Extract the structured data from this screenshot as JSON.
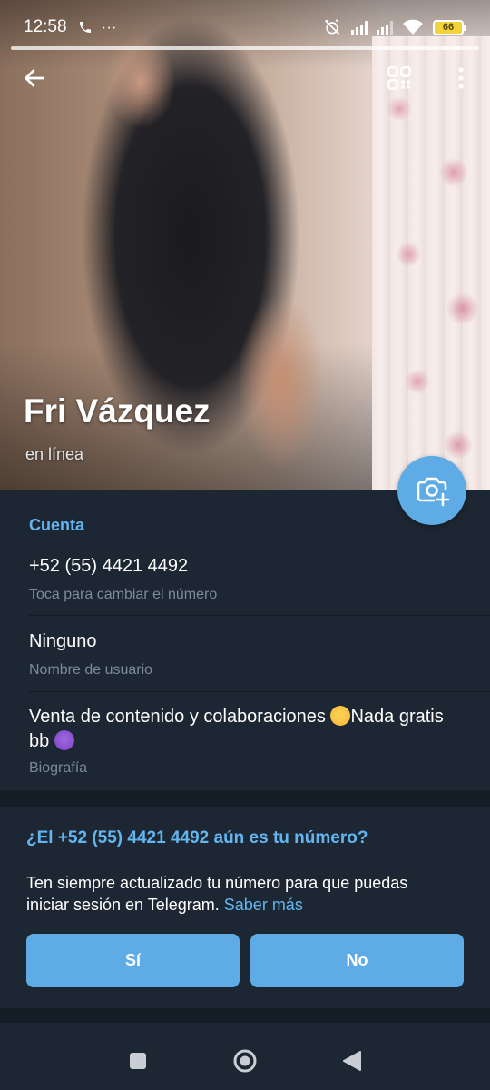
{
  "status_bar": {
    "time": "12:58",
    "dots": "···",
    "battery_level": "66"
  },
  "story_progress": 1.0,
  "profile": {
    "name": "Fri Vázquez",
    "status": "en línea"
  },
  "account": {
    "section_title": "Cuenta",
    "phone_value": "+52 (55) 4421 4492",
    "phone_label": "Toca para cambiar el número",
    "username_value": "Ninguno",
    "username_label": "Nombre de usuario",
    "bio_part1": "Venta de contenido y colaboraciones ",
    "bio_part2": "Nada gratis bb ",
    "bio_label": "Biografía"
  },
  "phone_check": {
    "title": "¿El +52 (55) 4421 4492 aún es tu número?",
    "text": "Ten siempre actualizado tu número para que puedas iniciar sesión en Telegram. ",
    "link": "Saber más",
    "yes_label": "Sí",
    "no_label": "No"
  },
  "icons": {
    "back": "arrow-left-icon",
    "qr": "qr-code-icon",
    "more": "more-vertical-icon",
    "camera": "add-photo-icon"
  },
  "colors": {
    "accent": "#64b5ef",
    "button": "#5eabe5",
    "background": "#1d2733",
    "battery": "#f3d23b"
  }
}
